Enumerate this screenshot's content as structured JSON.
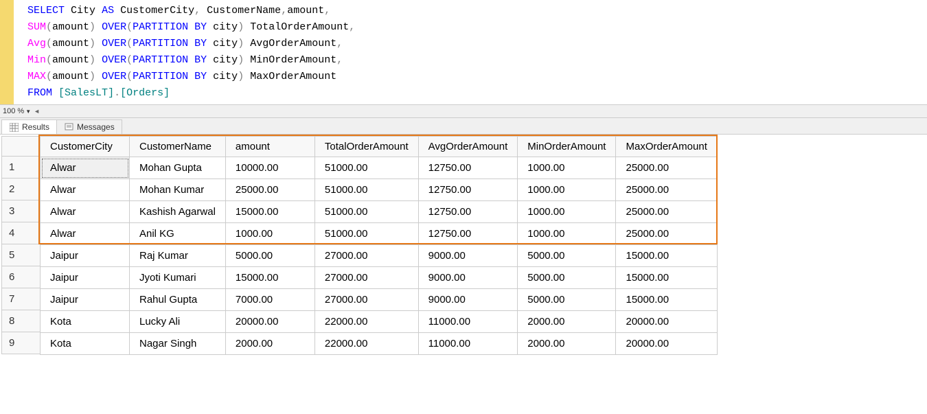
{
  "sql": {
    "line1": {
      "select": "SELECT",
      "col1": "City",
      "as": "AS",
      "alias": "CustomerCity",
      "comma1": ",",
      "col2": "CustomerName",
      "comma2": ",",
      "col3": "amount",
      "comma3": ","
    },
    "line2": {
      "func": "SUM",
      "lp": "(",
      "arg": "amount",
      "rp": ")",
      "over": "OVER",
      "lp2": "(",
      "part": "PARTITION",
      "by": "BY",
      "pcol": "city",
      "rp2": ")",
      "alias": "TotalOrderAmount",
      "comma": ","
    },
    "line3": {
      "func": "Avg",
      "lp": "(",
      "arg": "amount",
      "rp": ")",
      "over": "OVER",
      "lp2": "(",
      "part": "PARTITION",
      "by": "BY",
      "pcol": "city",
      "rp2": ")",
      "alias": "AvgOrderAmount",
      "comma": ","
    },
    "line4": {
      "func": "Min",
      "lp": "(",
      "arg": "amount",
      "rp": ")",
      "over": "OVER",
      "lp2": "(",
      "part": "PARTITION",
      "by": "BY",
      "pcol": "city",
      "rp2": ")",
      "alias": "MinOrderAmount",
      "comma": ","
    },
    "line5": {
      "func": "MAX",
      "lp": "(",
      "arg": "amount",
      "rp": ")",
      "over": "OVER",
      "lp2": "(",
      "part": "PARTITION",
      "by": "BY",
      "pcol": "city",
      "rp2": ")",
      "alias": "MaxOrderAmount"
    },
    "line6": {
      "from": "FROM",
      "sp": " ",
      "lb1": "[",
      "schema": "SalesLT",
      "rb1": "]",
      "dot": ".",
      "lb2": "[",
      "table": "Orders",
      "rb2": "]"
    }
  },
  "zoom": {
    "label": "100 %"
  },
  "tabs": {
    "results": "Results",
    "messages": "Messages"
  },
  "grid": {
    "headers": [
      "CustomerCity",
      "CustomerName",
      "amount",
      "TotalOrderAmount",
      "AvgOrderAmount",
      "MinOrderAmount",
      "MaxOrderAmount"
    ],
    "rownums": [
      "1",
      "2",
      "3",
      "4",
      "5",
      "6",
      "7",
      "8",
      "9"
    ],
    "rows": [
      [
        "Alwar",
        "Mohan Gupta",
        "10000.00",
        "51000.00",
        "12750.00",
        "1000.00",
        "25000.00"
      ],
      [
        "Alwar",
        "Mohan Kumar",
        "25000.00",
        "51000.00",
        "12750.00",
        "1000.00",
        "25000.00"
      ],
      [
        "Alwar",
        "Kashish Agarwal",
        "15000.00",
        "51000.00",
        "12750.00",
        "1000.00",
        "25000.00"
      ],
      [
        "Alwar",
        "Anil KG",
        "1000.00",
        "51000.00",
        "12750.00",
        "1000.00",
        "25000.00"
      ],
      [
        "Jaipur",
        "Raj Kumar",
        "5000.00",
        "27000.00",
        "9000.00",
        "5000.00",
        "15000.00"
      ],
      [
        "Jaipur",
        "Jyoti Kumari",
        "15000.00",
        "27000.00",
        "9000.00",
        "5000.00",
        "15000.00"
      ],
      [
        "Jaipur",
        "Rahul Gupta",
        "7000.00",
        "27000.00",
        "9000.00",
        "5000.00",
        "15000.00"
      ],
      [
        "Kota",
        "Lucky Ali",
        "20000.00",
        "22000.00",
        "11000.00",
        "2000.00",
        "20000.00"
      ],
      [
        "Kota",
        "Nagar Singh",
        "2000.00",
        "22000.00",
        "11000.00",
        "2000.00",
        "20000.00"
      ]
    ]
  }
}
